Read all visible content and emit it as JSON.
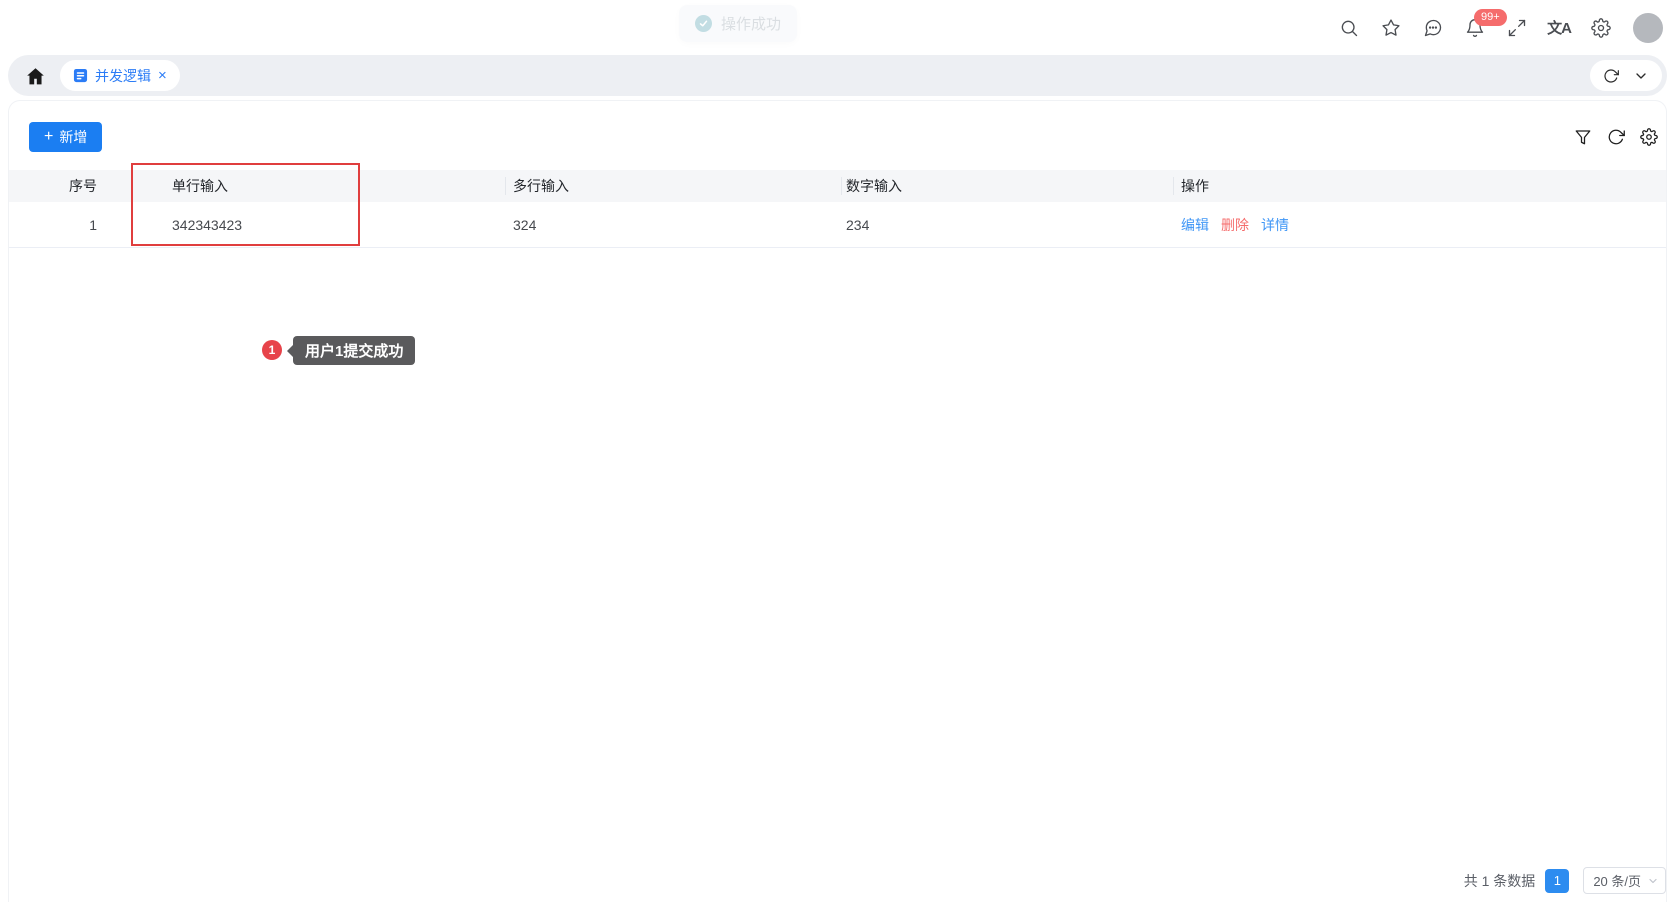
{
  "topbar": {
    "toast_text": "操作成功",
    "badge_count": "99+",
    "translate_glyph": "文A"
  },
  "tabbar": {
    "active_tab_label": "并发逻辑",
    "close_glyph": "×"
  },
  "toolbar": {
    "add_plus": "+",
    "add_label": "新增"
  },
  "table": {
    "columns": {
      "index": "序号",
      "single_line": "单行输入",
      "multi_line": "多行输入",
      "number": "数字输入",
      "actions": "操作"
    },
    "row": {
      "index": "1",
      "single_line": "342343423",
      "multi_line": "324",
      "number": "234"
    },
    "row_actions": {
      "edit": "编辑",
      "delete": "删除",
      "detail": "详情"
    }
  },
  "annotation": {
    "step_number": "1",
    "tooltip_text": "用户1提交成功"
  },
  "pagination": {
    "total_text": "共 1 条数据",
    "current_page": "1",
    "page_size_text": "20 条/页"
  },
  "colors": {
    "primary_blue": "#1b7ef2",
    "tab_blue": "#2b7cf6",
    "link_blue": "#3f96f6",
    "danger_red": "#f56c6c",
    "annotation_red": "#e7434a",
    "highlight_border": "#e03e3e",
    "page_active_blue": "#2d8cf0",
    "tab_band_gray": "#edeff3",
    "header_gray": "#f5f6f8"
  }
}
